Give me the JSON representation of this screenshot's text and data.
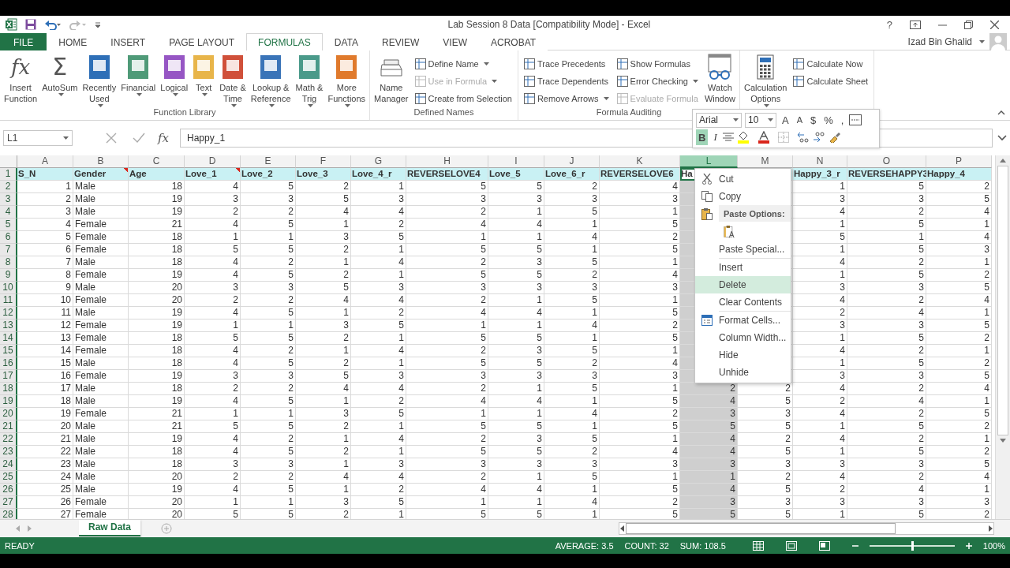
{
  "window": {
    "title": "Lab Session 8 Data  [Compatibility Mode] - Excel",
    "help": "?",
    "user": "Izad Bin Ghalid"
  },
  "tabs": [
    {
      "label": "FILE",
      "kind": "file",
      "selected": false
    },
    {
      "label": "HOME",
      "kind": "tab",
      "selected": false
    },
    {
      "label": "INSERT",
      "kind": "tab",
      "selected": false
    },
    {
      "label": "PAGE LAYOUT",
      "kind": "tab",
      "selected": false
    },
    {
      "label": "FORMULAS",
      "kind": "tab",
      "selected": true
    },
    {
      "label": "DATA",
      "kind": "tab",
      "selected": false
    },
    {
      "label": "REVIEW",
      "kind": "tab",
      "selected": false
    },
    {
      "label": "VIEW",
      "kind": "tab",
      "selected": false
    },
    {
      "label": "ACROBAT",
      "kind": "tab",
      "selected": false
    }
  ],
  "ribbon": {
    "groups": [
      {
        "label": "Function Library",
        "items": [
          {
            "kind": "glyph",
            "glyph": "fx",
            "lines": [
              "Insert",
              "Function"
            ],
            "dropdown": false
          },
          {
            "kind": "glyph",
            "glyph": "Σ",
            "lines": [
              "AutoSum"
            ],
            "dropdown": true
          },
          {
            "kind": "tile",
            "color": "#2e6fb7",
            "lines": [
              "Recently",
              "Used"
            ],
            "dropdown": true
          },
          {
            "kind": "tile",
            "color": "#4f9a78",
            "lines": [
              "Financial"
            ],
            "dropdown": true
          },
          {
            "kind": "tile",
            "color": "#9656c4",
            "lines": [
              "Logical"
            ],
            "dropdown": true
          },
          {
            "kind": "tile",
            "color": "#e8b54a",
            "lines": [
              "Text"
            ],
            "dropdown": true
          },
          {
            "kind": "tile",
            "color": "#d0503a",
            "lines": [
              "Date &",
              "Time"
            ],
            "dropdown": true
          },
          {
            "kind": "tile",
            "color": "#3a74b8",
            "lines": [
              "Lookup &",
              "Reference"
            ],
            "dropdown": true
          },
          {
            "kind": "tile",
            "color": "#4a9a8a",
            "lines": [
              "Math &",
              "Trig"
            ],
            "dropdown": true
          },
          {
            "kind": "tile",
            "color": "#e07a2c",
            "lines": [
              "More",
              "Functions"
            ],
            "dropdown": true
          }
        ]
      },
      {
        "label": "Defined Names",
        "items": [
          {
            "kind": "names",
            "lines": [
              "Name",
              "Manager"
            ],
            "dropdown": false
          },
          {
            "kind": "stack",
            "items": [
              {
                "label": "Define Name",
                "dropdown": true,
                "disabled": false
              },
              {
                "label": "Use in Formula",
                "dropdown": true,
                "disabled": true
              },
              {
                "label": "Create from Selection",
                "dropdown": false,
                "disabled": false
              }
            ]
          }
        ]
      },
      {
        "label": "Formula Auditing",
        "items": [
          {
            "kind": "stack",
            "items": [
              {
                "label": "Trace Precedents",
                "dropdown": false,
                "disabled": false
              },
              {
                "label": "Trace Dependents",
                "dropdown": false,
                "disabled": false
              },
              {
                "label": "Remove Arrows",
                "dropdown": true,
                "disabled": false
              }
            ]
          },
          {
            "kind": "stack",
            "items": [
              {
                "label": "Show Formulas",
                "dropdown": false,
                "disabled": false
              },
              {
                "label": "Error Checking",
                "dropdown": true,
                "disabled": false
              },
              {
                "label": "Evaluate Formula",
                "dropdown": false,
                "disabled": true
              }
            ]
          },
          {
            "kind": "watch",
            "lines": [
              "Watch",
              "Window"
            ],
            "dropdown": false
          }
        ]
      },
      {
        "items": [
          {
            "kind": "calc",
            "lines": [
              "Calculation",
              "Options"
            ],
            "dropdown": true
          },
          {
            "kind": "stack",
            "items": [
              {
                "label": "Calculate Now",
                "dropdown": false,
                "disabled": false
              },
              {
                "label": "Calculate Sheet",
                "dropdown": false,
                "disabled": false
              }
            ]
          }
        ]
      }
    ]
  },
  "mini_toolbar": {
    "font": "Arial",
    "size": "10",
    "grow": "A",
    "shrink": "A",
    "symbols": [
      "$",
      "%",
      ","
    ],
    "bold": {
      "label": "B",
      "on": true
    },
    "italic": {
      "label": "I",
      "on": false
    }
  },
  "formula_bar": {
    "name_box": "L1",
    "fx": "fx",
    "value": "Happy_1"
  },
  "table": {
    "columns": [
      {
        "letter": "A",
        "kind": "number",
        "selected": false
      },
      {
        "letter": "B",
        "kind": "text",
        "selected": false
      },
      {
        "letter": "C",
        "kind": "number",
        "selected": false
      },
      {
        "letter": "D",
        "kind": "number",
        "selected": false
      },
      {
        "letter": "E",
        "kind": "number",
        "selected": false
      },
      {
        "letter": "F",
        "kind": "number",
        "selected": false
      },
      {
        "letter": "G",
        "kind": "number",
        "selected": false
      },
      {
        "letter": "H",
        "kind": "number",
        "selected": false
      },
      {
        "letter": "I",
        "kind": "number",
        "selected": false
      },
      {
        "letter": "J",
        "kind": "number",
        "selected": false
      },
      {
        "letter": "K",
        "kind": "number",
        "selected": false
      },
      {
        "letter": "L",
        "kind": "number",
        "selected": true
      },
      {
        "letter": "M",
        "kind": "number",
        "selected": false
      },
      {
        "letter": "N",
        "kind": "number",
        "selected": false
      },
      {
        "letter": "O",
        "kind": "number",
        "selected": false
      },
      {
        "letter": "P",
        "kind": "number",
        "selected": false
      }
    ],
    "header_row": "1",
    "header_cells": [
      {
        "text": "S_N",
        "comment": false
      },
      {
        "text": "Gender",
        "comment": true
      },
      {
        "text": "Age",
        "comment": false
      },
      {
        "text": "Love_1",
        "comment": true
      },
      {
        "text": "Love_2",
        "comment": false
      },
      {
        "text": "Love_3",
        "comment": false
      },
      {
        "text": "Love_4_r",
        "comment": false
      },
      {
        "text": "REVERSELOVE4",
        "comment": false
      },
      {
        "text": "Love_5",
        "comment": false
      },
      {
        "text": "Love_6_r",
        "comment": false
      },
      {
        "text": "REVERSELOVE6",
        "comment": false
      },
      {
        "text": "Ha",
        "comment": false
      },
      null,
      {
        "text": "Happy_3_r",
        "comment": false
      },
      {
        "text": "REVERSEHAPPY3",
        "comment": false
      },
      {
        "text": "Happy_4",
        "comment": false
      }
    ],
    "rows": [
      {
        "n": "2",
        "cells": [
          "1",
          "Male",
          "18",
          "4",
          "5",
          "2",
          "1",
          "5",
          "5",
          "2",
          "4",
          null,
          null,
          "1",
          "5",
          "2"
        ]
      },
      {
        "n": "3",
        "cells": [
          "2",
          "Male",
          "19",
          "3",
          "3",
          "5",
          "3",
          "3",
          "3",
          "3",
          "3",
          null,
          null,
          "3",
          "3",
          "5"
        ]
      },
      {
        "n": "4",
        "cells": [
          "3",
          "Male",
          "19",
          "2",
          "2",
          "4",
          "4",
          "2",
          "1",
          "5",
          "1",
          null,
          null,
          "4",
          "2",
          "4"
        ]
      },
      {
        "n": "5",
        "cells": [
          "4",
          "Female",
          "21",
          "4",
          "5",
          "1",
          "2",
          "4",
          "4",
          "1",
          "5",
          null,
          null,
          "1",
          "5",
          "1"
        ]
      },
      {
        "n": "6",
        "cells": [
          "5",
          "Female",
          "18",
          "1",
          "1",
          "3",
          "5",
          "1",
          "1",
          "4",
          "2",
          null,
          null,
          "5",
          "1",
          "4"
        ]
      },
      {
        "n": "7",
        "cells": [
          "6",
          "Female",
          "18",
          "5",
          "5",
          "2",
          "1",
          "5",
          "5",
          "1",
          "5",
          null,
          null,
          "1",
          "5",
          "3"
        ]
      },
      {
        "n": "8",
        "cells": [
          "7",
          "Male",
          "18",
          "4",
          "2",
          "1",
          "4",
          "2",
          "3",
          "5",
          "1",
          null,
          null,
          "4",
          "2",
          "1"
        ]
      },
      {
        "n": "9",
        "cells": [
          "8",
          "Female",
          "19",
          "4",
          "5",
          "2",
          "1",
          "5",
          "5",
          "2",
          "4",
          null,
          null,
          "1",
          "5",
          "2"
        ]
      },
      {
        "n": "10",
        "cells": [
          "9",
          "Male",
          "20",
          "3",
          "3",
          "5",
          "3",
          "3",
          "3",
          "3",
          "3",
          null,
          null,
          "3",
          "3",
          "5"
        ]
      },
      {
        "n": "11",
        "cells": [
          "10",
          "Female",
          "20",
          "2",
          "2",
          "4",
          "4",
          "2",
          "1",
          "5",
          "1",
          null,
          null,
          "4",
          "2",
          "4"
        ]
      },
      {
        "n": "12",
        "cells": [
          "11",
          "Male",
          "19",
          "4",
          "5",
          "1",
          "2",
          "4",
          "4",
          "1",
          "5",
          null,
          null,
          "2",
          "4",
          "1"
        ]
      },
      {
        "n": "13",
        "cells": [
          "12",
          "Female",
          "19",
          "1",
          "1",
          "3",
          "5",
          "1",
          "1",
          "4",
          "2",
          null,
          null,
          "3",
          "3",
          "5"
        ]
      },
      {
        "n": "14",
        "cells": [
          "13",
          "Female",
          "18",
          "5",
          "5",
          "2",
          "1",
          "5",
          "5",
          "1",
          "5",
          null,
          null,
          "1",
          "5",
          "2"
        ]
      },
      {
        "n": "15",
        "cells": [
          "14",
          "Female",
          "18",
          "4",
          "2",
          "1",
          "4",
          "2",
          "3",
          "5",
          "1",
          null,
          null,
          "4",
          "2",
          "1"
        ]
      },
      {
        "n": "16",
        "cells": [
          "15",
          "Male",
          "18",
          "4",
          "5",
          "2",
          "1",
          "5",
          "5",
          "2",
          "4",
          null,
          null,
          "1",
          "5",
          "2"
        ]
      },
      {
        "n": "17",
        "cells": [
          "16",
          "Female",
          "19",
          "3",
          "3",
          "5",
          "3",
          "3",
          "3",
          "3",
          "3",
          null,
          null,
          "3",
          "3",
          "5"
        ]
      },
      {
        "n": "18",
        "cells": [
          "17",
          "Male",
          "18",
          "2",
          "2",
          "4",
          "4",
          "2",
          "1",
          "5",
          "1",
          "2",
          "2",
          "4",
          "2",
          "4"
        ]
      },
      {
        "n": "19",
        "cells": [
          "18",
          "Male",
          "19",
          "4",
          "5",
          "1",
          "2",
          "4",
          "4",
          "1",
          "5",
          "4",
          "5",
          "2",
          "4",
          "1"
        ]
      },
      {
        "n": "20",
        "cells": [
          "19",
          "Female",
          "21",
          "1",
          "1",
          "3",
          "5",
          "1",
          "1",
          "4",
          "2",
          "3",
          "3",
          "4",
          "2",
          "5"
        ]
      },
      {
        "n": "21",
        "cells": [
          "20",
          "Male",
          "21",
          "5",
          "5",
          "2",
          "1",
          "5",
          "5",
          "1",
          "5",
          "5",
          "5",
          "1",
          "5",
          "2"
        ]
      },
      {
        "n": "22",
        "cells": [
          "21",
          "Male",
          "19",
          "4",
          "2",
          "1",
          "4",
          "2",
          "3",
          "5",
          "1",
          "4",
          "2",
          "4",
          "2",
          "1"
        ]
      },
      {
        "n": "23",
        "cells": [
          "22",
          "Male",
          "18",
          "4",
          "5",
          "2",
          "1",
          "5",
          "5",
          "2",
          "4",
          "4",
          "5",
          "1",
          "5",
          "2"
        ]
      },
      {
        "n": "24",
        "cells": [
          "23",
          "Male",
          "18",
          "3",
          "3",
          "1",
          "3",
          "3",
          "3",
          "3",
          "3",
          "3",
          "3",
          "3",
          "3",
          "5"
        ]
      },
      {
        "n": "25",
        "cells": [
          "24",
          "Male",
          "20",
          "2",
          "2",
          "4",
          "4",
          "2",
          "1",
          "5",
          "1",
          "1",
          "2",
          "4",
          "2",
          "4"
        ]
      },
      {
        "n": "26",
        "cells": [
          "25",
          "Male",
          "19",
          "4",
          "5",
          "1",
          "2",
          "4",
          "4",
          "1",
          "5",
          "4",
          "5",
          "2",
          "4",
          "1"
        ]
      },
      {
        "n": "27",
        "cells": [
          "26",
          "Female",
          "20",
          "1",
          "1",
          "3",
          "5",
          "1",
          "1",
          "4",
          "2",
          "3",
          "3",
          "3",
          "3",
          "3"
        ]
      },
      {
        "n": "28",
        "cells": [
          "27",
          "Female",
          "20",
          "5",
          "5",
          "2",
          "1",
          "5",
          "5",
          "1",
          "5",
          "5",
          "5",
          "1",
          "5",
          "2"
        ]
      }
    ]
  },
  "context_menu": {
    "items": [
      {
        "kind": "item",
        "label": "Cut",
        "selected": false
      },
      {
        "kind": "item",
        "label": "Copy",
        "selected": false
      },
      {
        "kind": "heading",
        "label": "Paste Options:"
      },
      {
        "kind": "paste_option"
      },
      {
        "kind": "item",
        "label": "Paste Special...",
        "selected": false
      },
      {
        "kind": "separator"
      },
      {
        "kind": "item",
        "label": "Insert",
        "selected": false
      },
      {
        "kind": "item",
        "label": "Delete",
        "selected": true
      },
      {
        "kind": "item",
        "label": "Clear Contents",
        "selected": false
      },
      {
        "kind": "separator"
      },
      {
        "kind": "item",
        "label": "Format Cells...",
        "selected": false
      },
      {
        "kind": "item",
        "label": "Column Width...",
        "selected": false
      },
      {
        "kind": "item",
        "label": "Hide",
        "selected": false
      },
      {
        "kind": "item",
        "label": "Unhide",
        "selected": false
      }
    ]
  },
  "sheets": [
    {
      "label": "Raw Data",
      "selected": true
    }
  ],
  "status_bar": {
    "mode": "READY",
    "stats": [
      "AVERAGE: 3.5",
      "COUNT: 32",
      "SUM: 108.5"
    ],
    "zoom": {
      "level": 0.5,
      "reading": "100%"
    }
  }
}
